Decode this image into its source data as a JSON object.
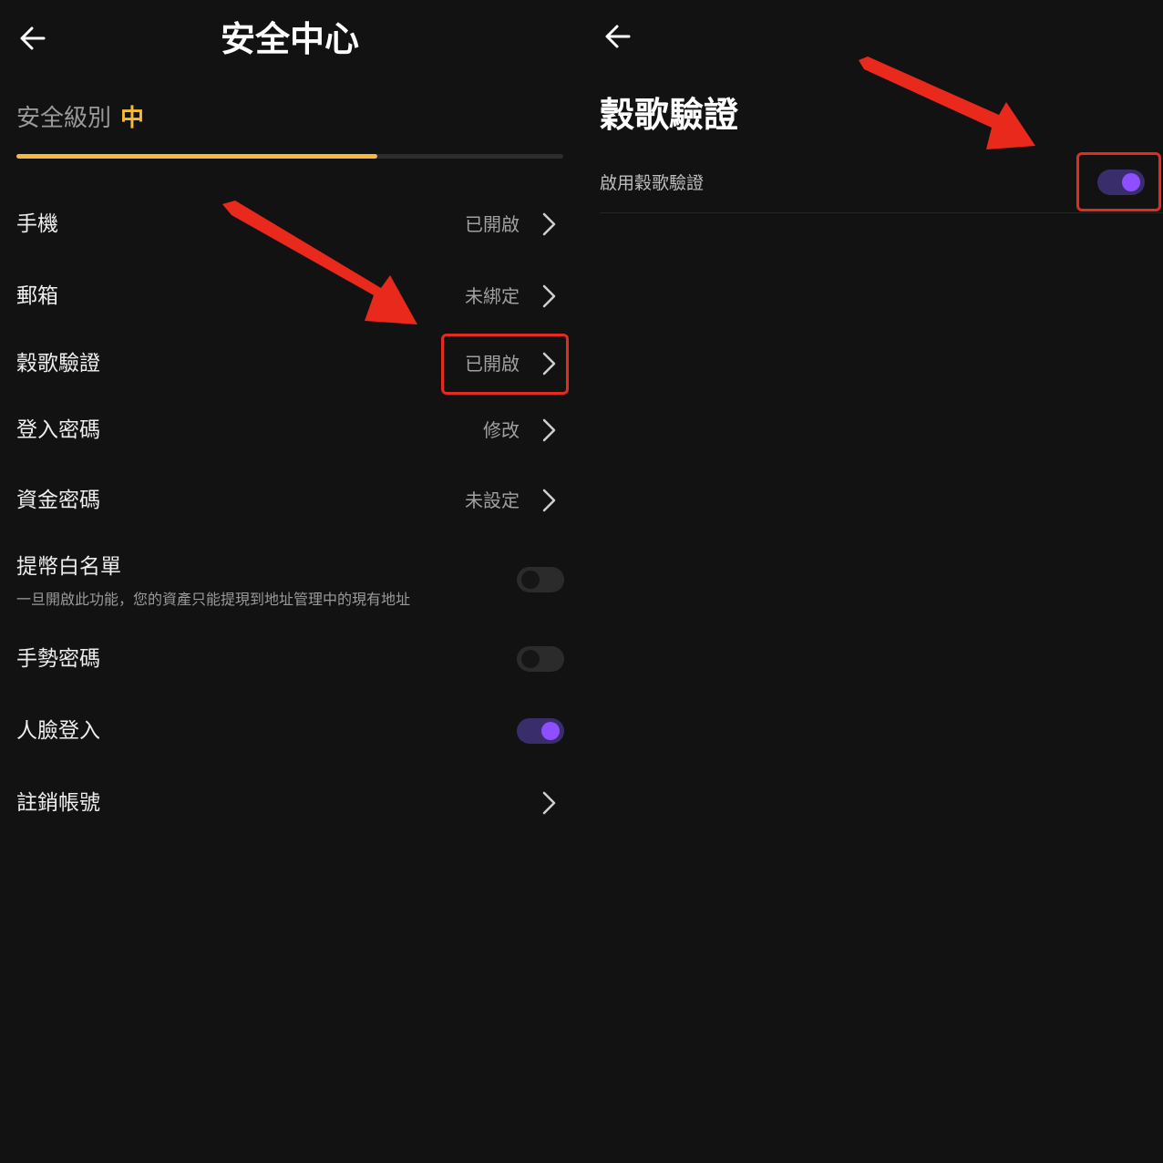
{
  "colors": {
    "background": "#121212",
    "accent_yellow": "#f5b93b",
    "accent_purple": "#8d4fff",
    "annotation_red": "#e12c1f",
    "muted_text": "#9a9a9a"
  },
  "left_screen": {
    "back_icon": "arrow-left-icon",
    "title": "安全中心",
    "security_level": {
      "label": "安全級別",
      "value": "中",
      "progress_percent": 66
    },
    "rows": [
      {
        "label": "手機",
        "value": "已開啟",
        "icon": "chevron-right-icon"
      },
      {
        "label": "郵箱",
        "value": "未綁定",
        "icon": "chevron-right-icon"
      },
      {
        "label": "穀歌驗證",
        "value": "已開啟",
        "icon": "chevron-right-icon"
      },
      {
        "label": "登入密碼",
        "value": "修改",
        "icon": "chevron-right-icon"
      },
      {
        "label": "資金密碼",
        "value": "未設定",
        "icon": "chevron-right-icon"
      }
    ],
    "withdraw_whitelist": {
      "label": "提幣白名單",
      "description": "一旦開啟此功能，您的資產只能提現到地址管理中的現有地址",
      "enabled": false
    },
    "gesture_password": {
      "label": "手勢密碼",
      "enabled": false
    },
    "face_login": {
      "label": "人臉登入",
      "enabled": true
    },
    "cancel_account": {
      "label": "註銷帳號",
      "icon": "chevron-right-icon"
    }
  },
  "right_screen": {
    "back_icon": "arrow-left-icon",
    "title": "穀歌驗證",
    "enable_row": {
      "label": "啟用穀歌驗證",
      "enabled": true
    }
  },
  "annotations": {
    "arrow_icon": "red-arrow-icon",
    "highlight_box_icon": "red-highlight-box"
  }
}
